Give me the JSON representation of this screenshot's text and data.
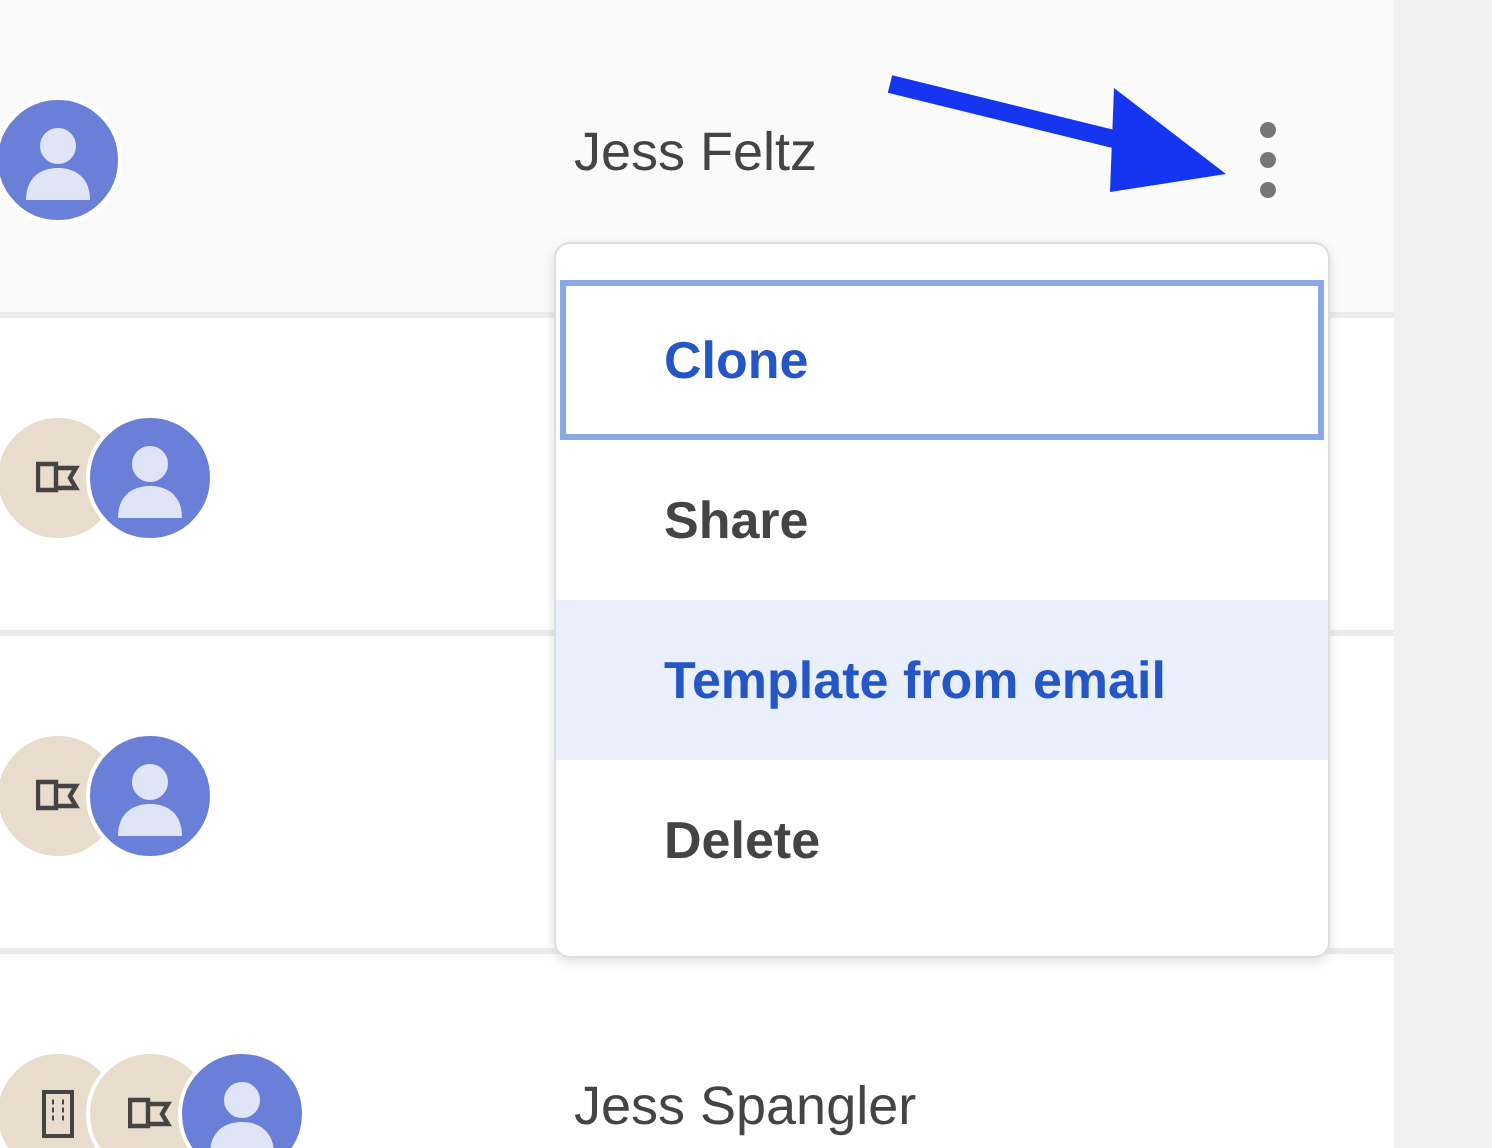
{
  "rows": [
    {
      "name": "Jess Feltz",
      "avatars": [
        {
          "kind": "photo"
        }
      ],
      "menu": {
        "items": [
          {
            "label": "Clone",
            "focused": true,
            "hovered": false
          },
          {
            "label": "Share",
            "focused": false,
            "hovered": false
          },
          {
            "label": "Template from email",
            "focused": false,
            "hovered": true
          },
          {
            "label": "Delete",
            "focused": false,
            "hovered": false
          }
        ]
      }
    },
    {
      "avatars": [
        {
          "kind": "flag"
        },
        {
          "kind": "photo"
        }
      ]
    },
    {
      "avatars": [
        {
          "kind": "flag"
        },
        {
          "kind": "photo"
        }
      ]
    },
    {
      "name": "Jess Spangler",
      "avatars": [
        {
          "kind": "building"
        },
        {
          "kind": "flag"
        },
        {
          "kind": "photo"
        }
      ]
    }
  ],
  "annotation_arrow": true
}
